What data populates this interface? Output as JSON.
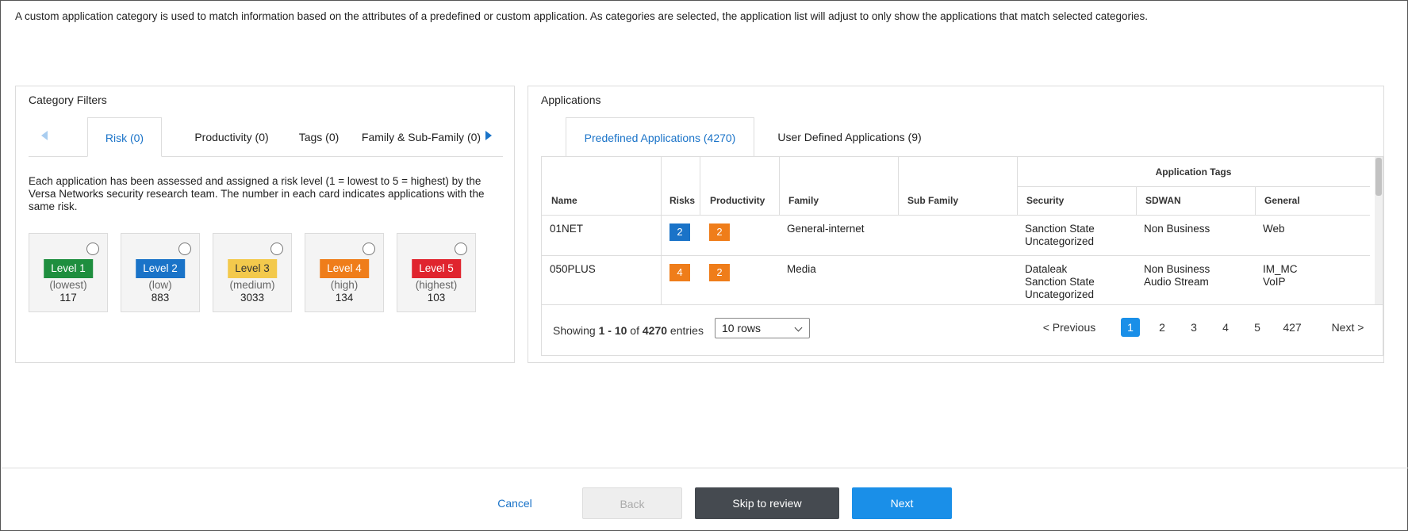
{
  "intro": "A custom application category is used to match information based on the attributes of a predefined or custom application. As categories are selected, the application list will adjust to only show the applications that match selected categories.",
  "category_filters": {
    "title": "Category Filters",
    "tabs": [
      {
        "label": "Risk (0)",
        "active": true
      },
      {
        "label": "Productivity (0)",
        "active": false
      },
      {
        "label": "Tags (0)",
        "active": false
      },
      {
        "label": "Family & Sub-Family (0)",
        "active": false
      }
    ],
    "description_line1": "Each application has been assessed and assigned a risk level (1 = lowest to 5 = highest) by the",
    "description_line2": "Versa Networks security research team. The number in each card indicates applications with the",
    "description_line3": "same risk.",
    "levels": [
      {
        "label": "Level 1",
        "desc": "(lowest)",
        "count": "117",
        "color": "#1e8e3e",
        "text_color": "#ffffff"
      },
      {
        "label": "Level 2",
        "desc": "(low)",
        "count": "883",
        "color": "#1a73c8",
        "text_color": "#ffffff"
      },
      {
        "label": "Level 3",
        "desc": "(medium)",
        "count": "3033",
        "color": "#f3c94c",
        "text_color": "#333333"
      },
      {
        "label": "Level 4",
        "desc": "(high)",
        "count": "134",
        "color": "#ef7d1a",
        "text_color": "#ffffff"
      },
      {
        "label": "Level 5",
        "desc": "(highest)",
        "count": "103",
        "color": "#e0242e",
        "text_color": "#ffffff"
      }
    ]
  },
  "applications": {
    "title": "Applications",
    "tabs": [
      {
        "label": "Predefined Applications (4270)",
        "active": true
      },
      {
        "label": "User Defined Applications (9)",
        "active": false
      }
    ],
    "table": {
      "group_header": "Application Tags",
      "columns": {
        "name": "Name",
        "risks": "Risks",
        "productivity": "Productivity",
        "family": "Family",
        "sub_family": "Sub Family",
        "security": "Security",
        "sdwan": "SDWAN",
        "general": "General"
      },
      "rows": [
        {
          "name": "01NET",
          "risk": "2",
          "risk_color": "#1a73c8",
          "productivity": "2",
          "productivity_color": "#ef7d1a",
          "family": "General-internet",
          "sub_family": "",
          "security": [
            "Sanction State",
            "Uncategorized"
          ],
          "sdwan": [
            "Non Business"
          ],
          "general": [
            "Web"
          ]
        },
        {
          "name": "050PLUS",
          "risk": "4",
          "risk_color": "#ef7d1a",
          "productivity": "2",
          "productivity_color": "#ef7d1a",
          "family": "Media",
          "sub_family": "",
          "security": [
            "Dataleak",
            "Sanction State",
            "Uncategorized"
          ],
          "sdwan": [
            "Non Business",
            "Audio Stream"
          ],
          "general": [
            "IM_MC",
            "VoIP"
          ]
        }
      ]
    },
    "pager": {
      "showing_prefix": "Showing",
      "range": "1 - 10",
      "of_word": "of",
      "total": "4270",
      "entries_word": "entries",
      "rows_select": "10 rows",
      "previous": "< Previous",
      "pages": [
        "1",
        "2",
        "3",
        "4",
        "5",
        "427"
      ],
      "current_page": "1",
      "next": "Next >"
    }
  },
  "footer": {
    "cancel": "Cancel",
    "back": "Back",
    "skip": "Skip to review",
    "next": "Next"
  }
}
